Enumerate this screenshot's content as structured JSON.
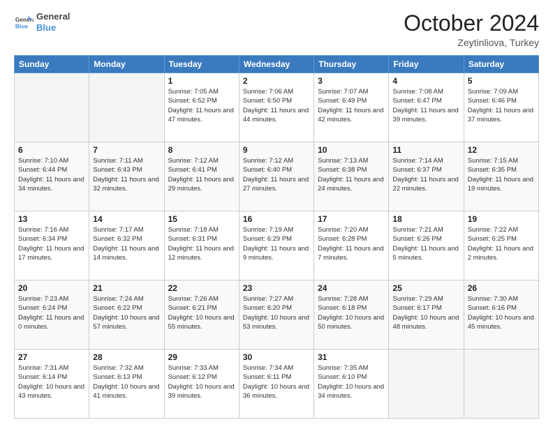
{
  "logo": {
    "text_general": "General",
    "text_blue": "Blue"
  },
  "header": {
    "title": "October 2024",
    "subtitle": "Zeytinliova, Turkey"
  },
  "weekdays": [
    "Sunday",
    "Monday",
    "Tuesday",
    "Wednesday",
    "Thursday",
    "Friday",
    "Saturday"
  ],
  "weeks": [
    [
      {
        "day": "",
        "sunrise": "",
        "sunset": "",
        "daylight": "",
        "empty": true
      },
      {
        "day": "",
        "sunrise": "",
        "sunset": "",
        "daylight": "",
        "empty": true
      },
      {
        "day": "1",
        "sunrise": "Sunrise: 7:05 AM",
        "sunset": "Sunset: 6:52 PM",
        "daylight": "Daylight: 11 hours and 47 minutes.",
        "empty": false
      },
      {
        "day": "2",
        "sunrise": "Sunrise: 7:06 AM",
        "sunset": "Sunset: 6:50 PM",
        "daylight": "Daylight: 11 hours and 44 minutes.",
        "empty": false
      },
      {
        "day": "3",
        "sunrise": "Sunrise: 7:07 AM",
        "sunset": "Sunset: 6:49 PM",
        "daylight": "Daylight: 11 hours and 42 minutes.",
        "empty": false
      },
      {
        "day": "4",
        "sunrise": "Sunrise: 7:08 AM",
        "sunset": "Sunset: 6:47 PM",
        "daylight": "Daylight: 11 hours and 39 minutes.",
        "empty": false
      },
      {
        "day": "5",
        "sunrise": "Sunrise: 7:09 AM",
        "sunset": "Sunset: 6:46 PM",
        "daylight": "Daylight: 11 hours and 37 minutes.",
        "empty": false
      }
    ],
    [
      {
        "day": "6",
        "sunrise": "Sunrise: 7:10 AM",
        "sunset": "Sunset: 6:44 PM",
        "daylight": "Daylight: 11 hours and 34 minutes.",
        "empty": false
      },
      {
        "day": "7",
        "sunrise": "Sunrise: 7:11 AM",
        "sunset": "Sunset: 6:43 PM",
        "daylight": "Daylight: 11 hours and 32 minutes.",
        "empty": false
      },
      {
        "day": "8",
        "sunrise": "Sunrise: 7:12 AM",
        "sunset": "Sunset: 6:41 PM",
        "daylight": "Daylight: 11 hours and 29 minutes.",
        "empty": false
      },
      {
        "day": "9",
        "sunrise": "Sunrise: 7:12 AM",
        "sunset": "Sunset: 6:40 PM",
        "daylight": "Daylight: 11 hours and 27 minutes.",
        "empty": false
      },
      {
        "day": "10",
        "sunrise": "Sunrise: 7:13 AM",
        "sunset": "Sunset: 6:38 PM",
        "daylight": "Daylight: 11 hours and 24 minutes.",
        "empty": false
      },
      {
        "day": "11",
        "sunrise": "Sunrise: 7:14 AM",
        "sunset": "Sunset: 6:37 PM",
        "daylight": "Daylight: 11 hours and 22 minutes.",
        "empty": false
      },
      {
        "day": "12",
        "sunrise": "Sunrise: 7:15 AM",
        "sunset": "Sunset: 6:35 PM",
        "daylight": "Daylight: 11 hours and 19 minutes.",
        "empty": false
      }
    ],
    [
      {
        "day": "13",
        "sunrise": "Sunrise: 7:16 AM",
        "sunset": "Sunset: 6:34 PM",
        "daylight": "Daylight: 11 hours and 17 minutes.",
        "empty": false
      },
      {
        "day": "14",
        "sunrise": "Sunrise: 7:17 AM",
        "sunset": "Sunset: 6:32 PM",
        "daylight": "Daylight: 11 hours and 14 minutes.",
        "empty": false
      },
      {
        "day": "15",
        "sunrise": "Sunrise: 7:18 AM",
        "sunset": "Sunset: 6:31 PM",
        "daylight": "Daylight: 11 hours and 12 minutes.",
        "empty": false
      },
      {
        "day": "16",
        "sunrise": "Sunrise: 7:19 AM",
        "sunset": "Sunset: 6:29 PM",
        "daylight": "Daylight: 11 hours and 9 minutes.",
        "empty": false
      },
      {
        "day": "17",
        "sunrise": "Sunrise: 7:20 AM",
        "sunset": "Sunset: 6:28 PM",
        "daylight": "Daylight: 11 hours and 7 minutes.",
        "empty": false
      },
      {
        "day": "18",
        "sunrise": "Sunrise: 7:21 AM",
        "sunset": "Sunset: 6:26 PM",
        "daylight": "Daylight: 11 hours and 5 minutes.",
        "empty": false
      },
      {
        "day": "19",
        "sunrise": "Sunrise: 7:22 AM",
        "sunset": "Sunset: 6:25 PM",
        "daylight": "Daylight: 11 hours and 2 minutes.",
        "empty": false
      }
    ],
    [
      {
        "day": "20",
        "sunrise": "Sunrise: 7:23 AM",
        "sunset": "Sunset: 6:24 PM",
        "daylight": "Daylight: 11 hours and 0 minutes.",
        "empty": false
      },
      {
        "day": "21",
        "sunrise": "Sunrise: 7:24 AM",
        "sunset": "Sunset: 6:22 PM",
        "daylight": "Daylight: 10 hours and 57 minutes.",
        "empty": false
      },
      {
        "day": "22",
        "sunrise": "Sunrise: 7:26 AM",
        "sunset": "Sunset: 6:21 PM",
        "daylight": "Daylight: 10 hours and 55 minutes.",
        "empty": false
      },
      {
        "day": "23",
        "sunrise": "Sunrise: 7:27 AM",
        "sunset": "Sunset: 6:20 PM",
        "daylight": "Daylight: 10 hours and 53 minutes.",
        "empty": false
      },
      {
        "day": "24",
        "sunrise": "Sunrise: 7:28 AM",
        "sunset": "Sunset: 6:18 PM",
        "daylight": "Daylight: 10 hours and 50 minutes.",
        "empty": false
      },
      {
        "day": "25",
        "sunrise": "Sunrise: 7:29 AM",
        "sunset": "Sunset: 6:17 PM",
        "daylight": "Daylight: 10 hours and 48 minutes.",
        "empty": false
      },
      {
        "day": "26",
        "sunrise": "Sunrise: 7:30 AM",
        "sunset": "Sunset: 6:16 PM",
        "daylight": "Daylight: 10 hours and 45 minutes.",
        "empty": false
      }
    ],
    [
      {
        "day": "27",
        "sunrise": "Sunrise: 7:31 AM",
        "sunset": "Sunset: 6:14 PM",
        "daylight": "Daylight: 10 hours and 43 minutes.",
        "empty": false
      },
      {
        "day": "28",
        "sunrise": "Sunrise: 7:32 AM",
        "sunset": "Sunset: 6:13 PM",
        "daylight": "Daylight: 10 hours and 41 minutes.",
        "empty": false
      },
      {
        "day": "29",
        "sunrise": "Sunrise: 7:33 AM",
        "sunset": "Sunset: 6:12 PM",
        "daylight": "Daylight: 10 hours and 39 minutes.",
        "empty": false
      },
      {
        "day": "30",
        "sunrise": "Sunrise: 7:34 AM",
        "sunset": "Sunset: 6:11 PM",
        "daylight": "Daylight: 10 hours and 36 minutes.",
        "empty": false
      },
      {
        "day": "31",
        "sunrise": "Sunrise: 7:35 AM",
        "sunset": "Sunset: 6:10 PM",
        "daylight": "Daylight: 10 hours and 34 minutes.",
        "empty": false
      },
      {
        "day": "",
        "sunrise": "",
        "sunset": "",
        "daylight": "",
        "empty": true
      },
      {
        "day": "",
        "sunrise": "",
        "sunset": "",
        "daylight": "",
        "empty": true
      }
    ]
  ]
}
